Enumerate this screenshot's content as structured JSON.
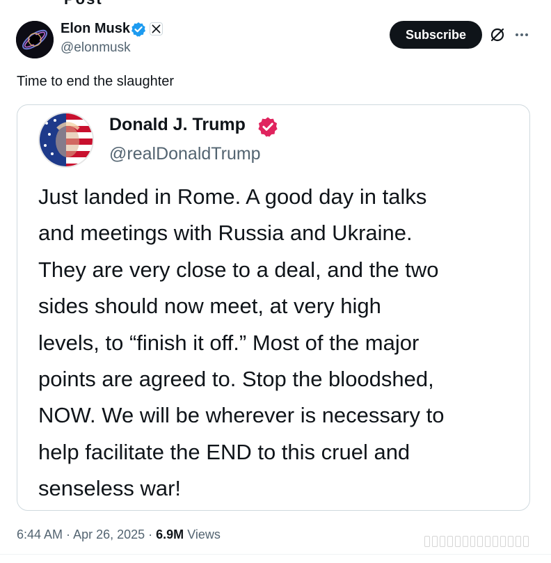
{
  "post": {
    "author_name": "Elon Musk",
    "author_handle": "@elonmusk",
    "subscribe_label": "Subscribe",
    "text": "Time to end the slaughter",
    "time": "6:44 AM",
    "date": "Apr 26, 2025",
    "views_count": "6.9M",
    "views_label": "Views"
  },
  "quote": {
    "author_name": "Donald J. Trump",
    "author_handle": "@realDonaldTrump",
    "lines": [
      "Just landed in Rome. A good day in talks",
      "and meetings with Russia and Ukraine.",
      "They are very close to a deal, and the two",
      "sides should now meet, at very high",
      "levels, to “finish it off.” Most of the major",
      "points are agreed to. Stop the bloodshed,",
      "NOW. We will be wherever is necessary to",
      "help facilitate the END to this cruel and",
      "senseless war!"
    ]
  },
  "icons": {
    "verified": "verified-badge-icon",
    "affiliate": "x-logo-icon",
    "grok": "grok-icon",
    "more": "more-icon",
    "quote_verified": "verified-badge-icon"
  },
  "colors": {
    "verified_blue": "#1d9bf0",
    "verified_pink": "#e0245e",
    "text_primary": "#0f1419",
    "text_secondary": "#536471",
    "button_bg": "#0f1419"
  }
}
